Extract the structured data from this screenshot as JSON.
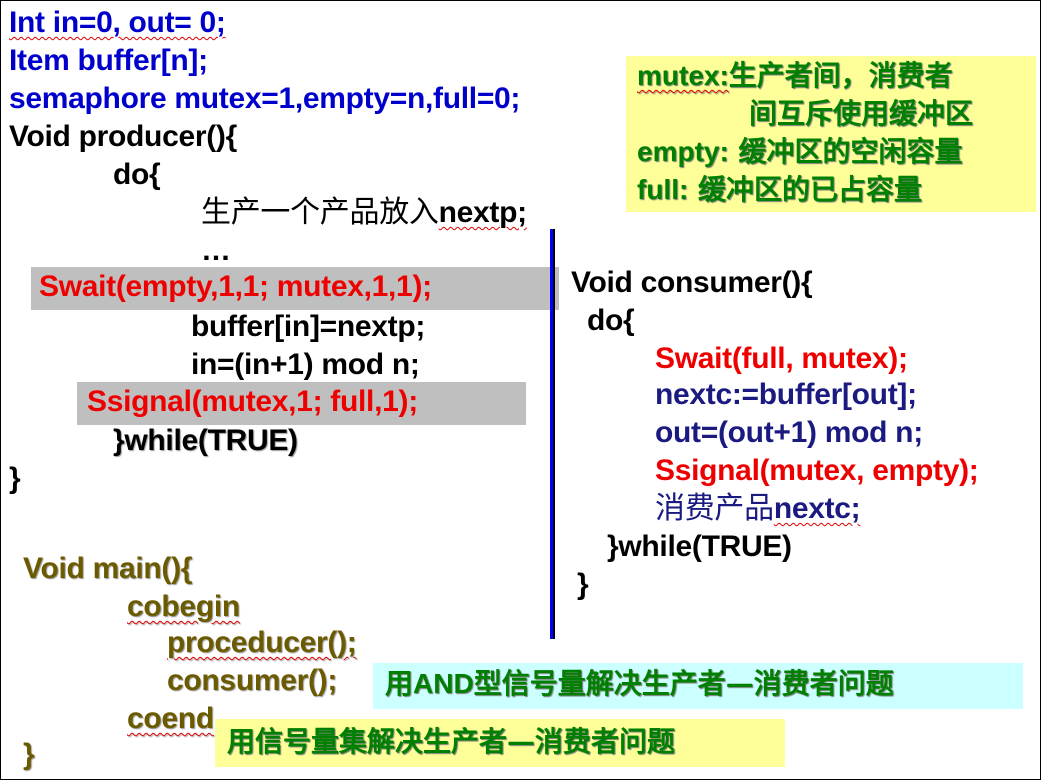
{
  "decls": {
    "l1": "Int in=0, out= 0;",
    "l2": "Item buffer[n];",
    "l3": "semaphore  mutex=1,empty=n,full=0;"
  },
  "producer": {
    "header": "Void producer(){",
    "do": "do{",
    "produce_cn": "生产一个产品放入",
    "produce_var": "nextp;",
    "ellipsis": "…",
    "swait": "Swait(empty,1,1; mutex,1,1);",
    "assign": "buffer[in]=nextp;",
    "incr": "in=(in+1) mod n;",
    "ssignal": "Ssignal(mutex,1; full,1);",
    "while": "}while(TRUE)",
    "close": "}"
  },
  "consumer": {
    "header": "Void consumer(){",
    "do": "do{",
    "swait": "Swait(full, mutex);",
    "take": "nextc:=buffer[out];",
    "incr": "out=(out+1) mod n;",
    "ssignal": "Ssignal(mutex, empty);",
    "consume_cn": "消费产品",
    "consume_var": "nextc;",
    "while": "}while(TRUE)",
    "close": "}"
  },
  "main": {
    "header": "Void main(){",
    "cobegin": "cobegin",
    "call1": "proceducer();",
    "call2": "consumer();",
    "coend": "coend",
    "close": "}"
  },
  "notes": {
    "mutex_key": "mutex:",
    "mutex_text1": "生产者间，消费者",
    "mutex_text2": "间互斥使用缓冲区",
    "empty_key": "empty:",
    "empty_text": " 缓冲区的空闲容量",
    "full_key": "full:",
    "full_text": " 缓冲区的已占容量"
  },
  "captions": {
    "and_pre": "用",
    "and_key": "AND",
    "and_post": "型信号量解决生产者—消费者问题",
    "set": "用信号量集解决生产者—消费者问题"
  },
  "colors": {
    "accent_blue": "#0000cc",
    "red": "#ee0000",
    "green": "#008000",
    "olive": "#6b5a00",
    "highlight_gray": "#bfbfbf",
    "note_yellow": "#ffff99",
    "caption_cyan": "#ccffff"
  }
}
